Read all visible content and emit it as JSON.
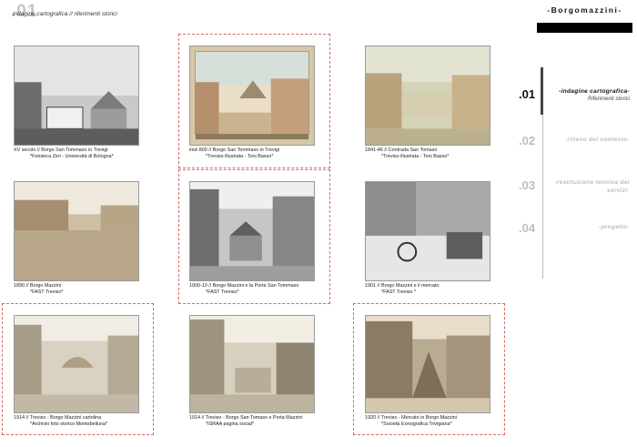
{
  "header": {
    "number": ".01",
    "subtitle": "indagine cartografica // riferimenti storici"
  },
  "brand": {
    "title": "-Borgomazzini-"
  },
  "nav": [
    {
      "num": ".01",
      "label": "-indagine cartografica-",
      "sub": "Riferimenti storici",
      "active": true
    },
    {
      "num": ".02",
      "label": "-rilievo del contesto-",
      "active": false
    },
    {
      "num": ".03",
      "label": "-restituzione tecnica dei servizi-",
      "active": false
    },
    {
      "num": ".04",
      "label": "-progetto-",
      "active": false
    }
  ],
  "cards": [
    {
      "line1": "XV secolo // Borgo San Tommaso in Trevigi",
      "line2": "*Fototeca Zeri - Università di Bologna*"
    },
    {
      "line1": "inizi 800 // Borgo San Tommaso in Trevigi",
      "line2": "*Treviso illustrata - Toni Basso*"
    },
    {
      "line1": "1841-46 // Contrada San Tomaso",
      "line2": "*Treviso illustrata - Toni Basso*"
    },
    {
      "line1": "1890 // Borgo Mazzini",
      "line2": "*FAST Treviso*"
    },
    {
      "line1": "1900-10 // Borgo Mazzini e la Porta San Tommaso",
      "line2": "*FAST Treviso*"
    },
    {
      "line1": "1901 // Borgo Mazzini e il mercato",
      "line2": "*FAST Treviso *"
    },
    {
      "line1": "1914 // Treviso - Borgo Mazzini cartolina",
      "line2": "*Archivio foto storico Montebelluna*"
    },
    {
      "line1": "1914 // Treviso - Borgo San Tomaso e Porta Mazzini",
      "line2": "*ISRAA pagina social*"
    },
    {
      "line1": "1920 // Treviso - Mercato in Borgo Mazzini",
      "line2": "*Società Iconografica Trivigiana*"
    }
  ]
}
